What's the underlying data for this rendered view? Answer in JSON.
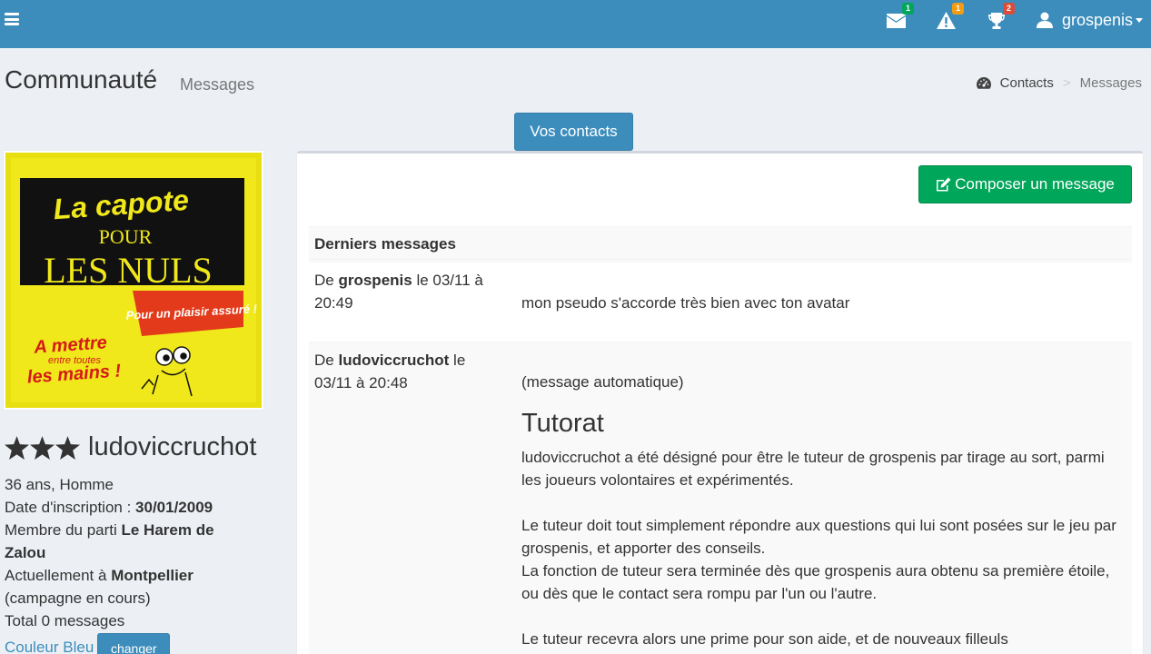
{
  "header": {
    "username": "grospenis",
    "badges": {
      "mail": "1",
      "warning": "1",
      "trophy": "2"
    }
  },
  "page": {
    "title": "Communauté",
    "subtitle": "Messages",
    "breadcrumb": {
      "contacts": "Contacts",
      "messages": "Messages"
    }
  },
  "buttons": {
    "vos_contacts": "Vos contacts",
    "composer": "Composer un message",
    "changer": "changer"
  },
  "avatar": {
    "line1": "La capote",
    "line2": "POUR",
    "line3": "LES NULS",
    "tag": "Pour un plaisir assuré !",
    "bottom1": "A mettre",
    "bottom2": "entre toutes",
    "bottom3": "les mains !"
  },
  "profile": {
    "name": "ludoviccruchot",
    "stars": 3,
    "age_gender": "36 ans, Homme",
    "inscription_label": "Date d'inscription : ",
    "inscription_date": "30/01/2009",
    "parti_label": "Membre du parti ",
    "parti": "Le Harem de Zalou",
    "location_label": "Actuellement à ",
    "location": "Montpellier",
    "campaign": "(campagne en cours)",
    "total_messages": "Total 0 messages",
    "couleur": "Couleur Bleu"
  },
  "messages_table": {
    "header": "Derniers messages",
    "rows": [
      {
        "from_label": "De ",
        "from": "grospenis",
        "date": " le 03/11 à 20:49",
        "text": "mon pseudo s'accorde très bien avec ton avatar"
      },
      {
        "from_label": "De ",
        "from": "ludoviccruchot",
        "date": " le 03/11 à 20:48",
        "auto": "(message automatique)",
        "heading": "Tutorat",
        "p1": "ludoviccruchot a été désigné pour être le tuteur de grospenis par tirage au sort, parmi les joueurs volontaires et expérimentés.",
        "p2": "Le tuteur doit tout simplement répondre aux questions qui lui sont posées sur le jeu par grospenis, et apporter des conseils.",
        "p3": "La fonction de tuteur sera terminée dès que grospenis aura obtenu sa première étoile, ou dès que le contact sera rompu par l'un ou l'autre.",
        "p4": "Le tuteur recevra alors une prime pour son aide, et de nouveaux filleuls"
      }
    ]
  }
}
